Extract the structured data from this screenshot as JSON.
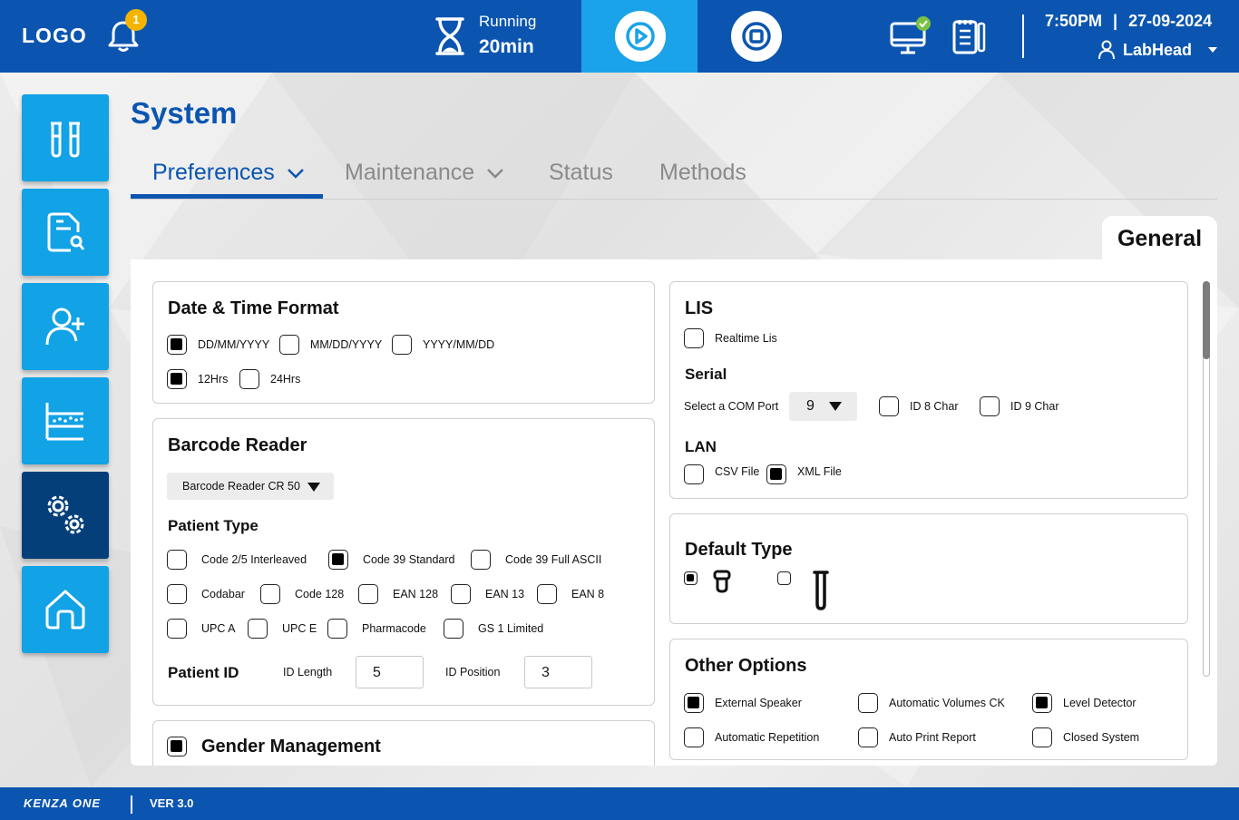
{
  "header": {
    "logo": "LOGO",
    "notification_count": "1",
    "run_status": "Running",
    "run_time": "20min",
    "time": "7:50PM",
    "date_separator": "|",
    "date": "27-09-2024",
    "user": "LabHead",
    "icons": [
      "bell-icon",
      "hourglass-icon",
      "play-icon",
      "stop-icon",
      "monitor-connected-icon",
      "clipboard-icon",
      "user-icon",
      "caret-down-icon"
    ]
  },
  "sidebar": {
    "items": [
      {
        "name": "samples",
        "icon": "sample-tubes-icon",
        "active": false
      },
      {
        "name": "reports",
        "icon": "report-search-icon",
        "active": false
      },
      {
        "name": "patients",
        "icon": "add-user-icon",
        "active": false
      },
      {
        "name": "quality-control",
        "icon": "chart-icon",
        "active": false
      },
      {
        "name": "system",
        "icon": "gears-icon",
        "active": true
      },
      {
        "name": "home",
        "icon": "home-icon",
        "active": false
      }
    ]
  },
  "page": {
    "title": "System",
    "tabs": [
      {
        "label": "Preferences",
        "active": true
      },
      {
        "label": "Maintenance",
        "active": false
      },
      {
        "label": "Status",
        "active": false
      },
      {
        "label": "Methods",
        "active": false
      }
    ],
    "section_tab": "General"
  },
  "date_time": {
    "title": "Date & Time Format",
    "date_formats": [
      {
        "label": "DD/MM/YYYY",
        "checked": true
      },
      {
        "label": "MM/DD/YYYY",
        "checked": false
      },
      {
        "label": "YYYY/MM/DD",
        "checked": false
      }
    ],
    "time_formats": [
      {
        "label": "12Hrs",
        "checked": true
      },
      {
        "label": "24Hrs",
        "checked": false
      }
    ]
  },
  "barcode": {
    "title": "Barcode Reader",
    "reader": "Barcode Reader CR 50",
    "patient_type_title": "Patient Type",
    "codes": [
      {
        "label": "Code 2/5  Interleaved",
        "checked": false
      },
      {
        "label": "Code 39 Standard",
        "checked": true
      },
      {
        "label": "Code 39 Full ASCII",
        "checked": false
      },
      {
        "label": "Codabar",
        "checked": false
      },
      {
        "label": "Code 128",
        "checked": false
      },
      {
        "label": "EAN 128",
        "checked": false
      },
      {
        "label": "EAN 13",
        "checked": false
      },
      {
        "label": "EAN 8",
        "checked": false
      },
      {
        "label": "UPC A",
        "checked": false
      },
      {
        "label": "UPC E",
        "checked": false
      },
      {
        "label": "Pharmacode",
        "checked": false
      },
      {
        "label": "GS 1 Limited",
        "checked": false
      }
    ],
    "patient_id_title": "Patient ID",
    "id_length_label": "ID Length",
    "id_length": "5",
    "id_position_label": "ID Position",
    "id_position": "3"
  },
  "gender": {
    "title": "Gender Management",
    "checked": true
  },
  "lis": {
    "title": "LIS",
    "realtime_label": "Realtime Lis",
    "realtime_checked": false,
    "serial_title": "Serial",
    "com_port_label": "Select a COM Port",
    "com_port": "9",
    "id8_label": "ID 8 Char",
    "id8_checked": false,
    "id9_label": "ID 9 Char",
    "id9_checked": false,
    "lan_title": "LAN",
    "csv_label": "CSV File",
    "csv_checked": false,
    "xml_label": "XML File",
    "xml_checked": true
  },
  "default_type": {
    "title": "Default Type",
    "options": [
      {
        "icon": "sample-cup-icon",
        "checked": true
      },
      {
        "icon": "test-tube-icon",
        "checked": false
      }
    ]
  },
  "other_options": {
    "title": "Other Options",
    "items": [
      {
        "label": "External Speaker",
        "checked": true
      },
      {
        "label": "Automatic Volumes CK",
        "checked": false
      },
      {
        "label": "Level Detector",
        "checked": true
      },
      {
        "label": "Automatic Repetition",
        "checked": false
      },
      {
        "label": "Auto Print Report",
        "checked": false
      },
      {
        "label": "Closed System",
        "checked": false
      }
    ]
  },
  "footer": {
    "brand": "KENZA ONE",
    "version": "VER 3.0"
  },
  "colors": {
    "primary": "#0b55b0",
    "accent": "#1aa3e8",
    "sidebar_active": "#053f7a",
    "badge": "#f5b400",
    "success": "#7cc242"
  }
}
